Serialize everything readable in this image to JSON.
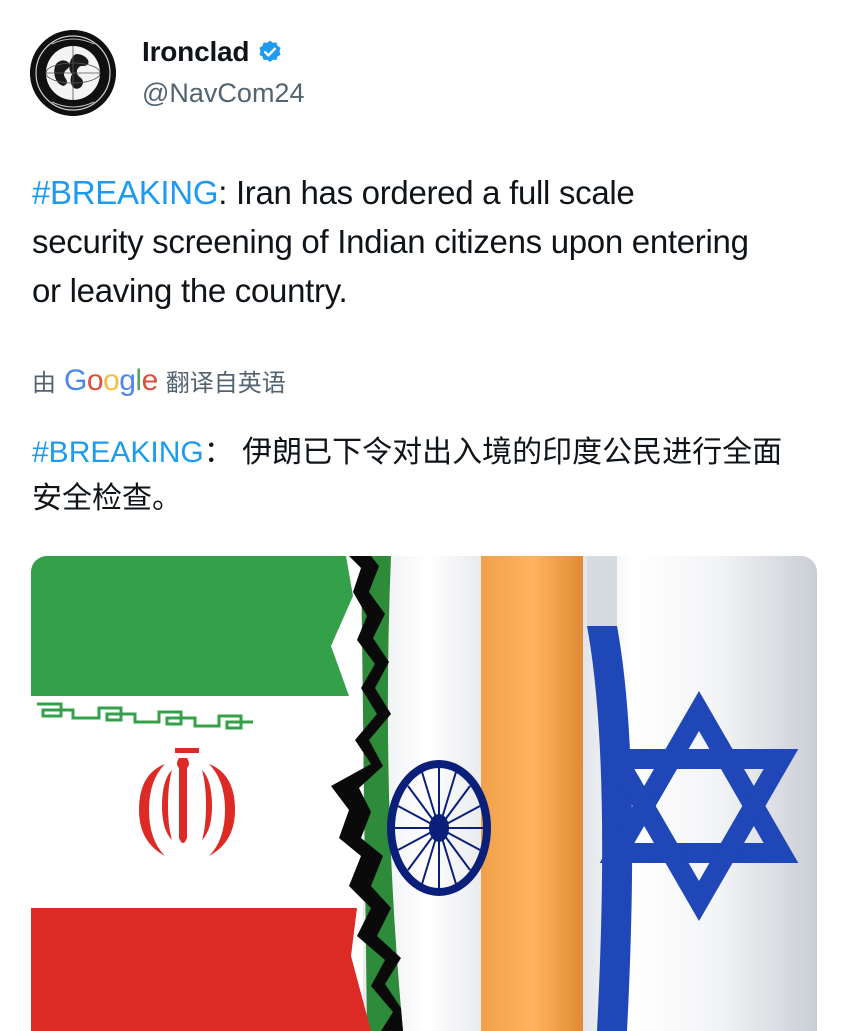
{
  "post": {
    "author": {
      "display_name": "Ironclad",
      "handle": "@NavCom24",
      "verified": true,
      "avatar_icon": "globe-emblem-icon"
    },
    "text": {
      "hashtag": "#BREAKING",
      "body": ": Iran has ordered a full scale security screening of Indian citizens upon entering or leaving the country."
    },
    "translation": {
      "prefix": "由",
      "provider": "Google",
      "suffix": "翻译自英语",
      "hashtag": "#BREAKING",
      "body": "： 伊朗已下令对出入境的印度公民进行全面安全检查。"
    },
    "media": {
      "flags": [
        "iran-flag",
        "india-flag",
        "israel-flag"
      ]
    }
  },
  "colors": {
    "hashtag": "#1d9bf0",
    "verified": "#1d9bf0",
    "secondary_text": "#536471",
    "iran_green": "#239f40",
    "iran_red": "#da0000",
    "india_saffron": "#ff9933",
    "india_navy": "#000080",
    "israel_blue": "#0038b8"
  }
}
